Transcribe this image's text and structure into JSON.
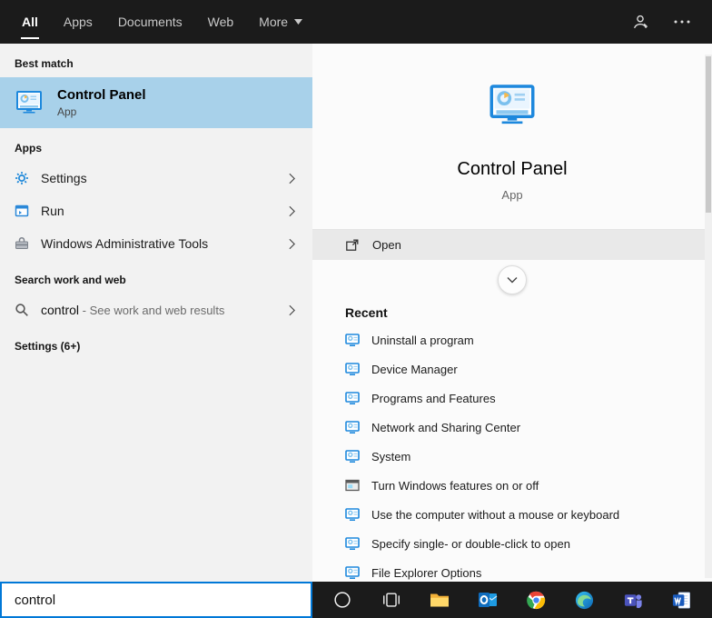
{
  "colors": {
    "accent": "#0078d7",
    "header-bg": "#1b1b1b",
    "left-bg": "#f2f2f2",
    "right-bg": "#fbfbfb",
    "highlight": "#a8d1ea",
    "open-row": "#e9e9e9"
  },
  "header": {
    "tabs": [
      {
        "label": "All"
      },
      {
        "label": "Apps"
      },
      {
        "label": "Documents"
      },
      {
        "label": "Web"
      },
      {
        "label": "More"
      }
    ],
    "icons": [
      "feedback-icon",
      "more-options-icon"
    ]
  },
  "left": {
    "best_match_label": "Best match",
    "best_match": {
      "title": "Control Panel",
      "subtitle": "App"
    },
    "apps_label": "Apps",
    "apps": [
      {
        "label": "Settings",
        "icon": "gear-icon"
      },
      {
        "label": "Run",
        "icon": "app-window-icon"
      },
      {
        "label": "Windows Administrative Tools",
        "icon": "toolbox-icon"
      }
    ],
    "web_label": "Search work and web",
    "web_search": {
      "query": "control",
      "suffix": " - See work and web results",
      "icon": "search-icon"
    },
    "settings_label": "Settings (6+)"
  },
  "right": {
    "app_title": "Control Panel",
    "app_subtitle": "App",
    "open_label": "Open",
    "recent_label": "Recent",
    "recent_items": [
      "Uninstall a program",
      "Device Manager",
      "Programs and Features",
      "Network and Sharing Center",
      "System",
      "Turn Windows features on or off",
      "Use the computer without a mouse or keyboard",
      "Specify single- or double-click to open",
      "File Explorer Options"
    ]
  },
  "search": {
    "value": "control"
  },
  "taskbar": {
    "icons": [
      "cortana-icon",
      "task-view-icon",
      "file-explorer-icon",
      "outlook-icon",
      "chrome-icon",
      "edge-icon",
      "teams-icon",
      "word-icon"
    ]
  }
}
